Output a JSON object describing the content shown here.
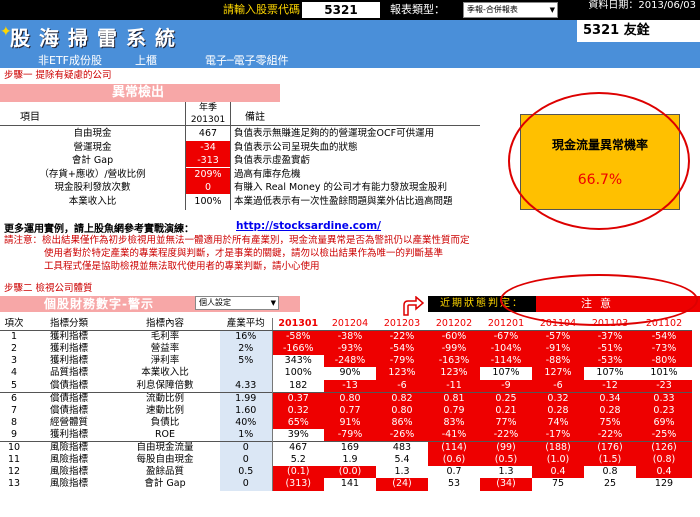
{
  "header": {
    "date_label": "資料日期：",
    "date_value": "2013/06/03",
    "prompt": "請輸入股票代碼",
    "stock_code": "5321",
    "report_type_label": "報表類型：",
    "report_type_value": "季報-合併報表",
    "system_title": "股海掃雷系統",
    "stock_display": "5321  友銓",
    "sub_labels": [
      "非ETF成份股",
      "上櫃",
      "電子─電子零組件"
    ]
  },
  "step1": {
    "label": "步驟一 提除有疑慮的公司",
    "band_title": "異常檢出",
    "col_item": "項目",
    "col_yq_1": "年季",
    "col_yq_2": "201301",
    "col_note": "備註",
    "rows": [
      {
        "item": "自由現金",
        "value": "467",
        "note": "負值表示無賺進足夠的的營運現金OCF可供運用",
        "red": false
      },
      {
        "item": "營運現金",
        "value": "-34",
        "note": "負值表示公司呈現失血的狀態",
        "red": true
      },
      {
        "item": "會計 Gap",
        "value": "-313",
        "note": "負值表示虛盈實虧",
        "red": true
      },
      {
        "item": "（存貨+應收）/營收比例",
        "value": "209%",
        "note": "過高有庫存危機",
        "red": true
      },
      {
        "item": "現金股利發放次數",
        "value": "0",
        "note": "有賺入 Real Money 的公司才有能力發放現金股利",
        "red": true
      },
      {
        "item": "本業收入比",
        "value": "100%",
        "note": "本業過低表示有一次性盈餘問題與業外佔比過高問題",
        "red": false
      }
    ],
    "ratio_label": "現金流量異常機率",
    "ratio_value": "66.7%"
  },
  "more": {
    "text": "更多運用實例，請上股魚網參考實戰演練：",
    "link": "http://stocksardine.com/",
    "notes": [
      "請注意：檢出結果僅作為初步檢視用並無法一體適用於所有產業別，現金流量異常是否為警訊仍以產業性質而定",
      "使用者對於特定產業的專業程度與判斷，才是事業的關鍵，請勿以檢出結果作為唯一的判斷基準",
      "工具程式僅是協助檢視並無法取代使用者的專業判斷，請小心使用"
    ]
  },
  "step2": {
    "label": "步驟二 檢視公司體質",
    "band_title": "個股財務數字-警示",
    "custom_select": "個人設定",
    "judge_label": "近期狀態判定：",
    "judge_value": "注意"
  },
  "fin_table": {
    "headers": [
      "項次",
      "指標分類",
      "指標內容",
      "產業平均",
      "201301",
      "201204",
      "201203",
      "201202",
      "201201",
      "201104",
      "201103",
      "201102"
    ],
    "rows": [
      {
        "no": "1",
        "cat": "獲利指標",
        "item": "毛利率",
        "avg": "16%",
        "vals": [
          "-58%",
          "-38%",
          "-22%",
          "-60%",
          "-67%",
          "-57%",
          "-37%",
          "-54%"
        ],
        "red": [
          1,
          1,
          1,
          1,
          1,
          1,
          1,
          1
        ]
      },
      {
        "no": "2",
        "cat": "獲利指標",
        "item": "營益率",
        "avg": "2%",
        "vals": [
          "-166%",
          "-93%",
          "-54%",
          "-99%",
          "-104%",
          "-91%",
          "-51%",
          "-73%"
        ],
        "red": [
          1,
          1,
          1,
          1,
          1,
          1,
          1,
          1
        ]
      },
      {
        "no": "3",
        "cat": "獲利指標",
        "item": "淨利率",
        "avg": "5%",
        "vals": [
          "343%",
          "-248%",
          "-79%",
          "-163%",
          "-114%",
          "-88%",
          "-53%",
          "-80%"
        ],
        "red": [
          0,
          1,
          1,
          1,
          1,
          1,
          1,
          1
        ]
      },
      {
        "no": "4",
        "cat": "品質指標",
        "item": "本業收入比",
        "avg": "",
        "vals": [
          "100%",
          "90%",
          "123%",
          "123%",
          "107%",
          "127%",
          "107%",
          "101%"
        ],
        "red": [
          0,
          0,
          1,
          1,
          0,
          1,
          0,
          0
        ]
      },
      {
        "no": "5",
        "cat": "償債指標",
        "item": "利息保障倍數",
        "avg": "4.33",
        "vals": [
          "182",
          "-13",
          "-6",
          "-11",
          "-9",
          "-6",
          "-12",
          "-23"
        ],
        "red": [
          0,
          1,
          1,
          1,
          1,
          1,
          1,
          1
        ]
      },
      {
        "no": "6",
        "cat": "償債指標",
        "item": "流動比例",
        "avg": "1.99",
        "vals": [
          "0.37",
          "0.80",
          "0.82",
          "0.81",
          "0.25",
          "0.32",
          "0.34",
          "0.33"
        ],
        "red": [
          1,
          1,
          1,
          1,
          1,
          1,
          1,
          1
        ]
      },
      {
        "no": "7",
        "cat": "償債指標",
        "item": "速動比例",
        "avg": "1.60",
        "vals": [
          "0.32",
          "0.77",
          "0.80",
          "0.79",
          "0.21",
          "0.28",
          "0.28",
          "0.23"
        ],
        "red": [
          1,
          1,
          1,
          1,
          1,
          1,
          1,
          1
        ]
      },
      {
        "no": "8",
        "cat": "經營體質",
        "item": "負債比",
        "avg": "40%",
        "vals": [
          "65%",
          "91%",
          "86%",
          "83%",
          "77%",
          "74%",
          "75%",
          "69%"
        ],
        "red": [
          1,
          1,
          1,
          1,
          1,
          1,
          1,
          1
        ]
      },
      {
        "no": "9",
        "cat": "獲利指標",
        "item": "ROE",
        "avg": "1%",
        "vals": [
          "39%",
          "-79%",
          "-26%",
          "-41%",
          "-22%",
          "-17%",
          "-22%",
          "-25%"
        ],
        "red": [
          0,
          1,
          1,
          1,
          1,
          1,
          1,
          1
        ]
      },
      {
        "no": "10",
        "cat": "風險指標",
        "item": "自由現金流量",
        "avg": "0",
        "vals": [
          "467",
          "169",
          "483",
          "(114)",
          "(99)",
          "(188)",
          "(176)",
          "(126)"
        ],
        "red": [
          0,
          0,
          0,
          1,
          1,
          1,
          1,
          1
        ]
      },
      {
        "no": "11",
        "cat": "風險指標",
        "item": "每股自由現金",
        "avg": "0",
        "vals": [
          "5.2",
          "1.9",
          "5.4",
          "(0.6)",
          "(0.5)",
          "(1.0)",
          "(1.5)",
          "(0.8)"
        ],
        "red": [
          0,
          0,
          0,
          1,
          1,
          1,
          1,
          1
        ]
      },
      {
        "no": "12",
        "cat": "風險指標",
        "item": "盈餘品質",
        "avg": "0.5",
        "vals": [
          "(0.1)",
          "(0.0)",
          "1.3",
          "0.7",
          "1.3",
          "0.4",
          "0.8",
          "0.4"
        ],
        "red": [
          1,
          1,
          0,
          0,
          0,
          1,
          0,
          1
        ]
      },
      {
        "no": "13",
        "cat": "風險指標",
        "item": "會計 Gap",
        "avg": "0",
        "vals": [
          "(313)",
          "141",
          "(24)",
          "53",
          "(34)",
          "75",
          "25",
          "129"
        ],
        "red": [
          1,
          0,
          1,
          0,
          1,
          0,
          0,
          0
        ]
      }
    ]
  },
  "colors": {
    "header_blue": "#4a8fd9",
    "alert_red": "#ee0000",
    "band_pink": "#f7a7a7",
    "ratio_box": "#ffc000"
  }
}
